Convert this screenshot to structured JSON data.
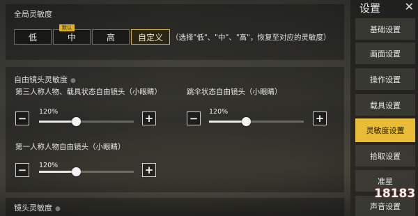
{
  "global": {
    "title": "全局灵敏度",
    "presets": [
      {
        "label": "低"
      },
      {
        "label": "中",
        "badge": "默认"
      },
      {
        "label": "高"
      },
      {
        "label": "自定义"
      }
    ],
    "selected_preset": "自定义",
    "description": "（选择\"低\"、\"中\"、\"高\"，恢复至对应的灵敏度）"
  },
  "free_camera": {
    "title": "自由镜头灵敏度",
    "third_person": {
      "label": "第三人称人物、载具状态自由镜头（小眼睛）",
      "value_text": "120%",
      "level": 0.5
    },
    "parachute": {
      "label": "跳伞状态自由镜头（小眼睛）",
      "value_text": "120%",
      "level": 0.5
    },
    "first_person": {
      "label": "第一人称人物自由镜头（小眼睛）",
      "value_text": "120%",
      "level": 0.5
    }
  },
  "lens": {
    "title": "镜头灵敏度"
  },
  "sidebar": {
    "title": "设置",
    "close_icon": "close-icon",
    "items": [
      {
        "label": "基础设置"
      },
      {
        "label": "画面设置"
      },
      {
        "label": "操作设置"
      },
      {
        "label": "载具设置"
      },
      {
        "label": "灵敏度设置"
      },
      {
        "label": "拾取设置"
      },
      {
        "label": "准星"
      },
      {
        "label": "声音设置"
      }
    ],
    "active_index": 4
  },
  "watermark": {
    "text": "18183"
  },
  "colors": {
    "accent": "#e9bc38",
    "panel": "#2a2a26"
  }
}
